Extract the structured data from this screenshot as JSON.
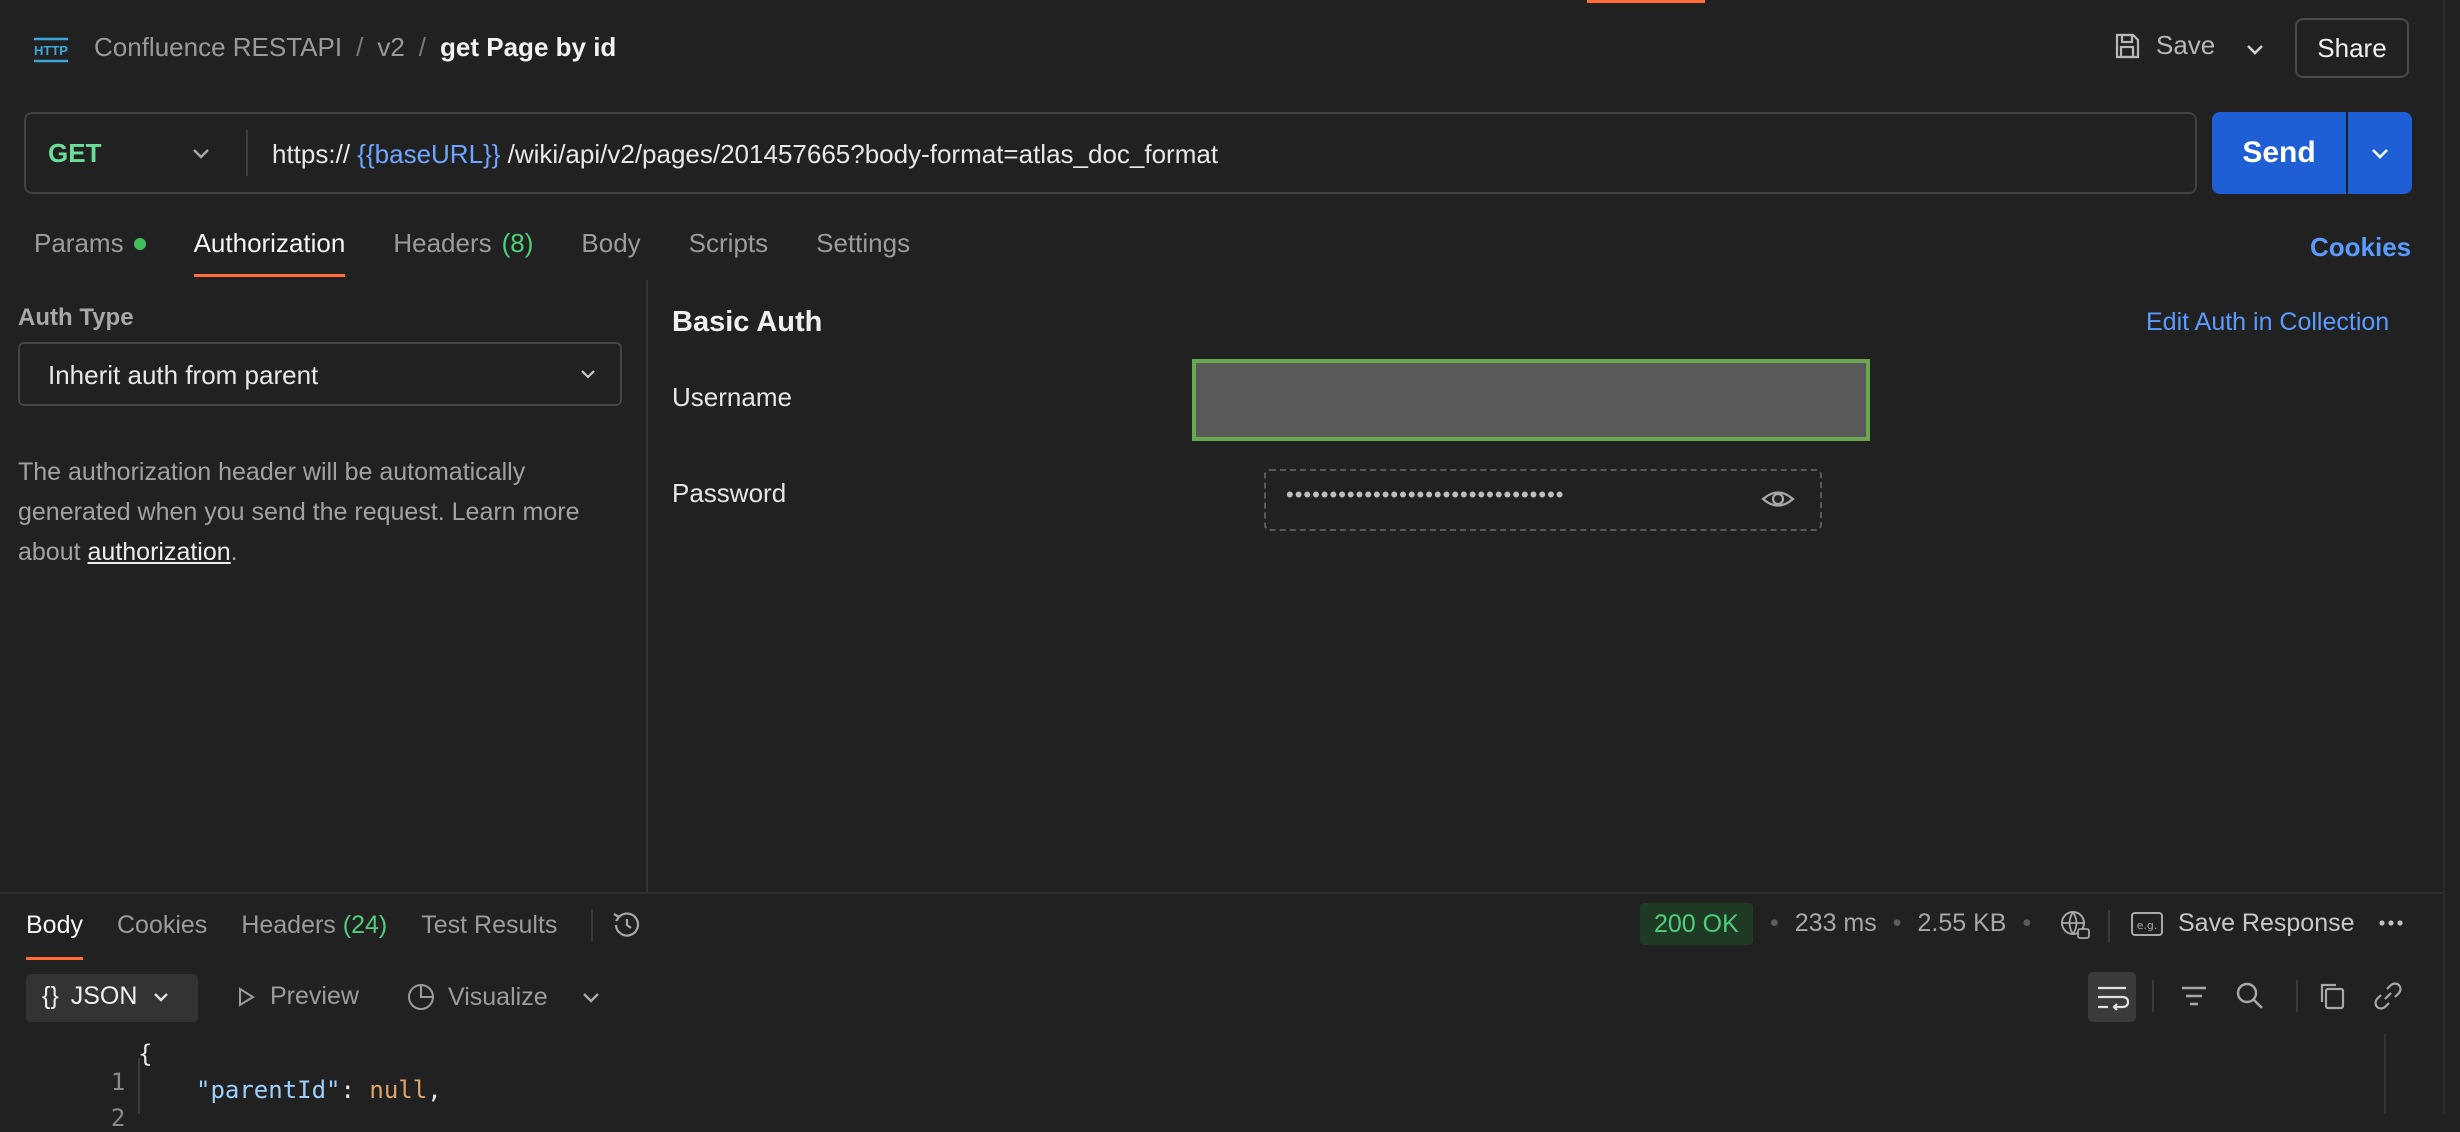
{
  "header": {
    "breadcrumb": [
      "Confluence RESTAPI",
      "v2",
      "get Page by id"
    ],
    "breadcrumb_sep": "/",
    "save_label": "Save",
    "share_label": "Share",
    "http_icon_text": "HTTP"
  },
  "request": {
    "method": "GET",
    "url_prefix": "https://",
    "url_var": "{{baseURL}}",
    "url_suffix": "/wiki/api/v2/pages/201457665?body-format=atlas_doc_format",
    "send_label": "Send"
  },
  "request_tabs": {
    "params": "Params",
    "authorization": "Authorization",
    "headers": "Headers",
    "headers_count": "(8)",
    "body": "Body",
    "scripts": "Scripts",
    "settings": "Settings",
    "cookies": "Cookies"
  },
  "auth": {
    "type_label": "Auth Type",
    "type_value": "Inherit auth from parent",
    "help_text": "The authorization header will be automatically generated when you send the request. Learn more about ",
    "help_link": "authorization",
    "help_end": ".",
    "section_title": "Basic Auth",
    "edit_link": "Edit Auth in Collection",
    "username_label": "Username",
    "username_value": "",
    "password_label": "Password",
    "password_masked": "••••••••••••••••••••••••••••••••"
  },
  "response": {
    "tabs": {
      "body": "Body",
      "cookies": "Cookies",
      "headers": "Headers",
      "headers_count": "(24)",
      "test_results": "Test Results"
    },
    "status": "200 OK",
    "time": "233 ms",
    "size": "2.55 KB",
    "save_response": "Save Response",
    "format": "JSON",
    "format_braces": "{}",
    "preview": "Preview",
    "visualize": "Visualize",
    "code": [
      {
        "num": "1",
        "text": "{"
      },
      {
        "num": "2",
        "key": "\"parentId\"",
        "colon": ": ",
        "value": "null",
        "tail": ","
      }
    ]
  },
  "colors": {
    "accent": "#ff6c37",
    "send": "#1f5fd6",
    "success": "#4fcf7a",
    "link": "#5a9bff"
  }
}
